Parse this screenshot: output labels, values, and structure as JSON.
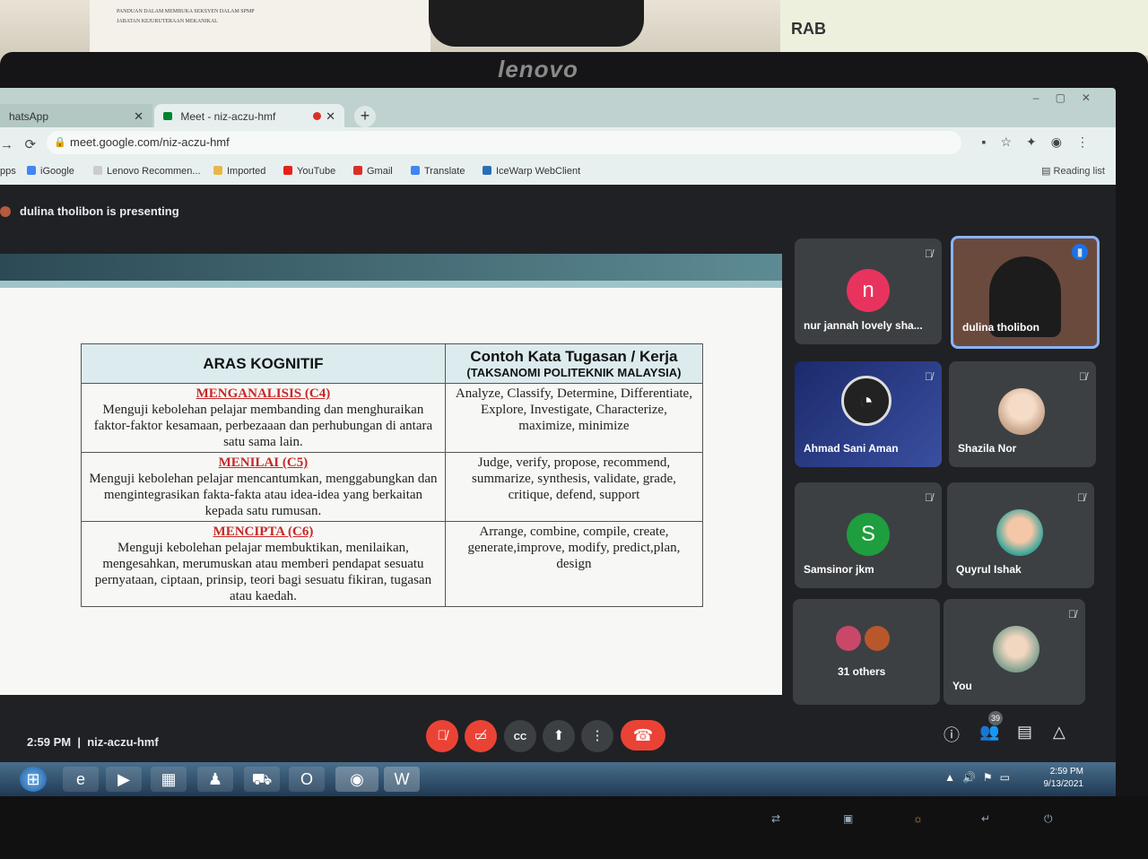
{
  "chrome": {
    "tab_whatsapp": "hatsApp",
    "tab_meet": "Meet - niz-aczu-hmf",
    "url": "meet.google.com/niz-aczu-hmf",
    "bookmarks": [
      "pps",
      "iGoogle",
      "Lenovo Recommen...",
      "Imported",
      "YouTube",
      "Gmail",
      "Translate",
      "IceWarp WebClient"
    ],
    "reading_list": "Reading list"
  },
  "monitor_brand": "lenovo",
  "calendar_label": "RAB",
  "meet": {
    "presenting": "dulina tholibon is presenting",
    "time": "2:59 PM",
    "meeting_code": "niz-aczu-hmf",
    "participants_badge": "39"
  },
  "slide": {
    "header_left": "ARAS KOGNITIF",
    "header_right_title": "Contoh Kata Tugasan / Kerja",
    "header_right_sub": "(TAKSANOMI POLITEKNIK MALAYSIA)",
    "rows": [
      {
        "level": "MENGANALISIS (C4)",
        "desc": "Menguji kebolehan pelajar membanding dan menghuraikan faktor-faktor kesamaan, perbezaaan dan perhubungan di antara satu sama lain.",
        "verbs": "Analyze, Classify, Determine, Differentiate, Explore, Investigate, Characterize, maximize, minimize"
      },
      {
        "level": "MENILAI (C5)",
        "desc": "Menguji kebolehan pelajar mencantumkan, menggabungkan dan mengintegrasikan fakta-fakta atau idea-idea yang berkaitan kepada satu rumusan.",
        "verbs": "Judge, verify, propose, recommend, summarize, synthesis, validate, grade, critique, defend, support"
      },
      {
        "level": "MENCIPTA (C6)",
        "desc": "Menguji kebolehan pelajar membuktikan, menilaikan, mengesahkan, merumuskan atau memberi pendapat sesuatu pernyataan, ciptaan, prinsip, teori bagi sesuatu fikiran, tugasan atau kaedah.",
        "verbs": "Arrange, combine, compile, create, generate,improve, modify, predict,plan, design"
      }
    ]
  },
  "tiles": {
    "t1": {
      "name": "nur jannah lovely sha...",
      "initial": "n",
      "color": "#e8335e"
    },
    "t2": {
      "name": "dulina tholibon"
    },
    "t3": {
      "name": "Ahmad Sani Aman"
    },
    "t4": {
      "name": "Shazila Nor"
    },
    "t5": {
      "name": "Samsinor jkm",
      "initial": "S",
      "color": "#1e9e3e"
    },
    "t6": {
      "name": "Quyrul Ishak"
    },
    "t7": {
      "name": "31 others"
    },
    "t8": {
      "name": "You"
    }
  },
  "taskbar": {
    "clock_time": "2:59 PM",
    "clock_date": "9/13/2021"
  }
}
